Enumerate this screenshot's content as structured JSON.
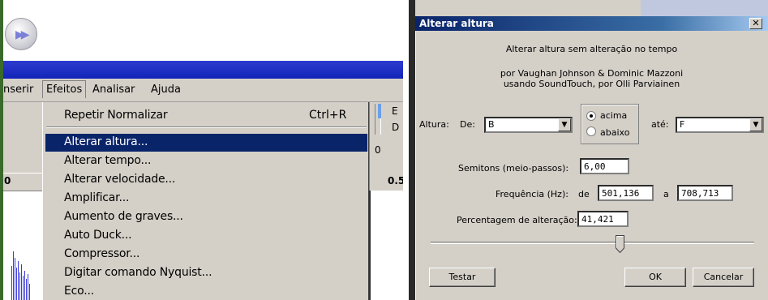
{
  "menubar": {
    "items": [
      "nserir",
      "Efeitos",
      "Analisar",
      "Ajuda"
    ]
  },
  "efeitos_menu": {
    "repeat_item": "Repetir Normalizar",
    "repeat_shortcut": "Ctrl+R",
    "items": [
      "Alterar altura...",
      "Alterar tempo...",
      "Alterar velocidade...",
      "Amplificar...",
      "Aumento de graves...",
      "Auto Duck...",
      "Compressor...",
      "Digitar comando Nyquist...",
      "Eco..."
    ],
    "highlighted_index": 0
  },
  "left_ruler": {
    "zero": "0"
  },
  "right_strip": {
    "labels": [
      "E",
      "D"
    ],
    "zero": "0",
    "ruler": "0.5"
  },
  "dialog": {
    "title": "Alterar altura",
    "close_glyph": "✕",
    "description": "Alterar altura sem alteração no tempo",
    "credits_line1": "por Vaughan Johnson & Dominic Mazzoni",
    "credits_line2": "usando SoundTouch, por Olli Parviainen",
    "pitch_label": "Altura:",
    "from_label": "De:",
    "from_value": "B",
    "to_label": "até:",
    "to_value": "F",
    "direction_up": "acima",
    "direction_down": "abaixo",
    "direction_selected": "acima",
    "semitones_label": "Semitons (meio-passos):",
    "semitones_value": "6,00",
    "frequency_label": "Frequência (Hz):",
    "frequency_from_label": "de",
    "frequency_from_value": "501,136",
    "frequency_to_label": "a",
    "frequency_to_value": "708,713",
    "percent_label": "Percentagem de alteração:",
    "percent_value": "41,421",
    "test_button": "Testar",
    "ok_button": "OK",
    "cancel_button": "Cancelar"
  },
  "colors": {
    "menu_highlight": "#0a246a",
    "titlebar_start": "#0a246a",
    "titlebar_end": "#a6caf0",
    "face": "#d4d0c8",
    "waveform": "#3a3ad8"
  }
}
